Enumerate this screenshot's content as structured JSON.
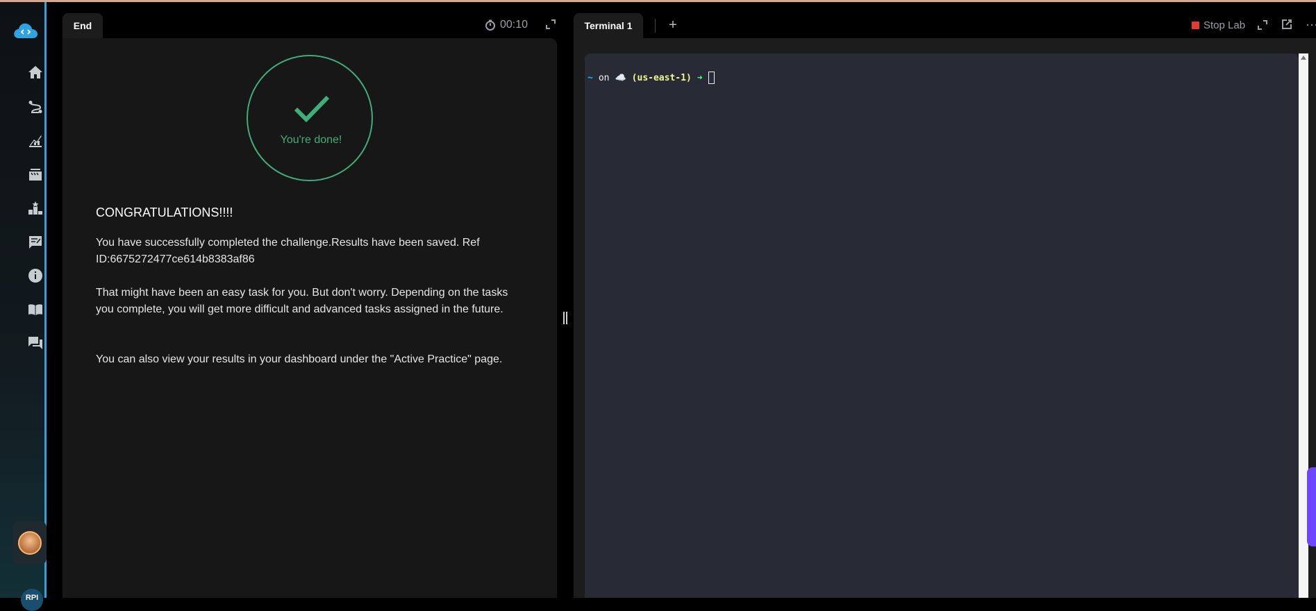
{
  "sidebar": {
    "items": [
      {
        "name": "home-icon"
      },
      {
        "name": "route-icon"
      },
      {
        "name": "progress-icon"
      },
      {
        "name": "cards-icon"
      },
      {
        "name": "leaderboard-icon"
      },
      {
        "name": "feedback-icon"
      },
      {
        "name": "info-icon"
      },
      {
        "name": "book-icon"
      },
      {
        "name": "chat-icon"
      }
    ],
    "user_initials": "RPI"
  },
  "left": {
    "tab_label": "End",
    "timer": "00:10",
    "done_text": "You're done!",
    "heading": "CONGRATULATIONS!!!!",
    "paragraphs": [
      "You have successfully completed the challenge.Results have been saved. Ref ID:6675272477ce614b8383af86",
      "That might have been an easy task for you. But don't worry. Depending on the tasks you complete, you will get more difficult and advanced tasks assigned in the future.",
      "You can also view your results in your dashboard under the \"Active Practice\" page."
    ]
  },
  "right": {
    "tab_label": "Terminal 1",
    "add_label": "+",
    "stop_label": "Stop Lab",
    "more_label": "···",
    "prompt": {
      "tilde": "~",
      "on": "on",
      "cloud": "☁️",
      "region": "(us-east-1)",
      "arrow": "➜"
    }
  },
  "colors": {
    "accent_green": "#3fae7b",
    "sidebar_border": "#2fa3df",
    "stop_red": "#e53935",
    "terminal_bg": "#282a36"
  }
}
